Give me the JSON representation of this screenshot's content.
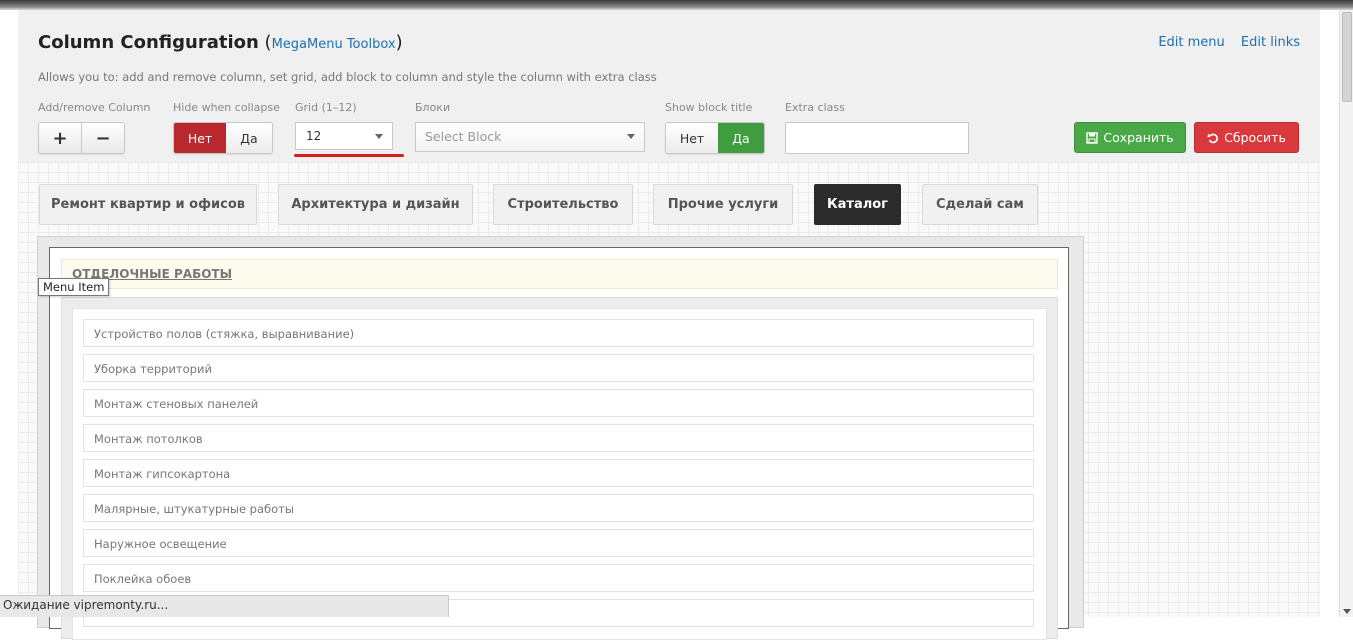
{
  "header": {
    "title": "Column Configuration",
    "paren_open": " (",
    "toolbox_link": "MegaMenu Toolbox",
    "paren_close": ")",
    "description": "Allows you to: add and remove column, set grid, add block to column and style the column with extra class",
    "edit_menu": "Edit menu",
    "edit_links": "Edit links"
  },
  "controls": {
    "add_remove_label": "Add/remove Column",
    "plus": "+",
    "minus": "−",
    "hide_collapse_label": "Hide when collapse",
    "hide_no": "Нет",
    "hide_yes": "Да",
    "hide_selected": "no",
    "grid_label": "Grid (1–12)",
    "grid_value": "12",
    "blocks_label": "Блоки",
    "block_placeholder": "Select Block",
    "show_title_label": "Show block title",
    "show_no": "Нет",
    "show_yes": "Да",
    "show_selected": "yes",
    "extra_class_label": "Extra class",
    "extra_class_value": "",
    "save": "Сохранить",
    "reset": "Сбросить"
  },
  "tabs": [
    {
      "label": "Ремонт квартир и офисов",
      "active": false
    },
    {
      "label": "Архитектура и дизайн",
      "active": false
    },
    {
      "label": "Строительство",
      "active": false
    },
    {
      "label": "Прочие услуги",
      "active": false
    },
    {
      "label": "Каталог",
      "active": true
    },
    {
      "label": "Сделай сам",
      "active": false
    }
  ],
  "menu": {
    "heading": "ОТДЕЛОЧНЫЕ РАБОТЫ",
    "tooltip": "Menu Item",
    "items": [
      "Устройство полов (стяжка, выравнивание)",
      "Уборка территорий",
      "Монтаж стеновых панелей",
      "Монтаж потолков",
      "Монтаж гипсокартона",
      "Малярные, штукатурные работы",
      "Наружное освещение",
      "Поклейка обоев",
      ""
    ]
  },
  "status": "Ожидание vipremonty.ru...",
  "colors": {
    "accent_link": "#1e6fb0",
    "save_green": "#4aa947",
    "reset_red": "#d9393c",
    "toggle_red": "#b8282c",
    "toggle_green": "#3f9c3f",
    "active_tab": "#2b2b2b"
  }
}
